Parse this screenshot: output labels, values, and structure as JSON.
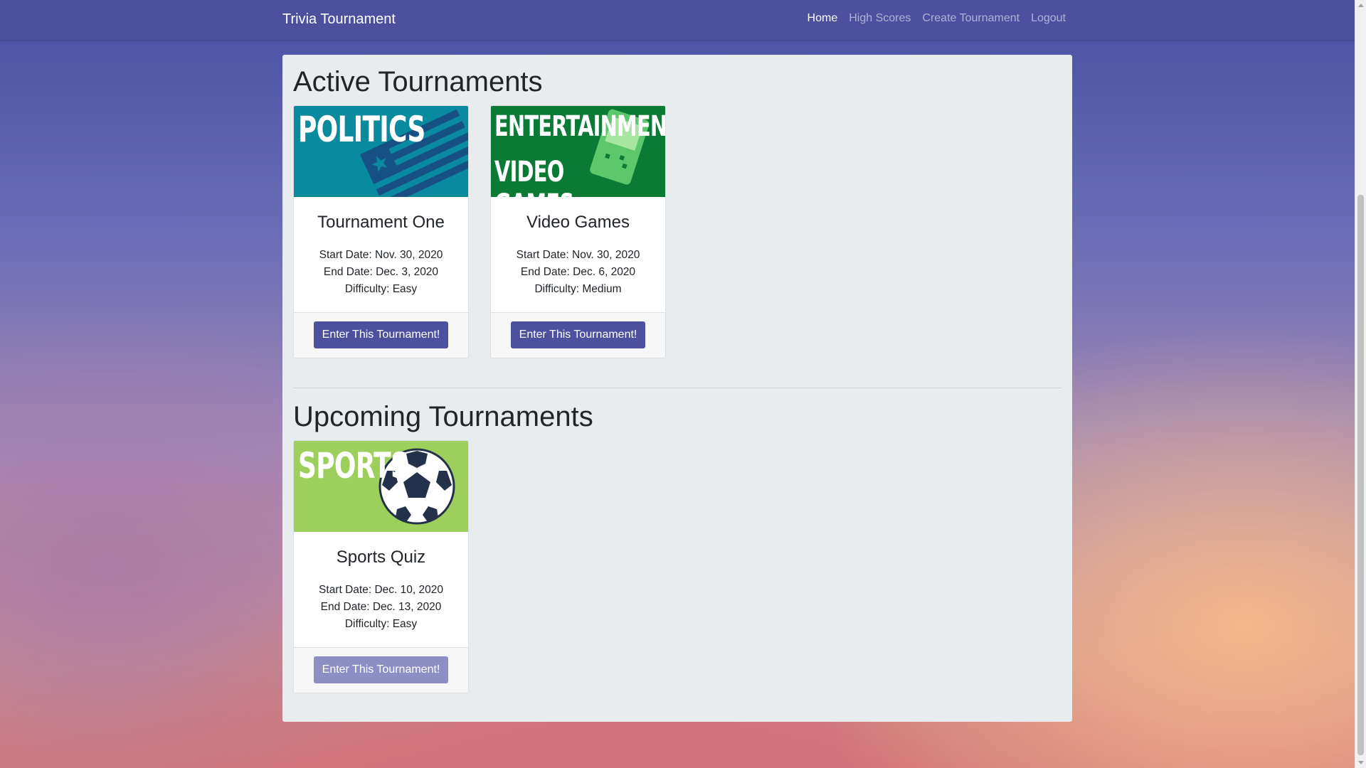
{
  "navbar": {
    "brand": "Trivia Tournament",
    "links": [
      "Home",
      "High Scores",
      "Create Tournament",
      "Logout"
    ],
    "active_index": 0
  },
  "sections": {
    "active": {
      "title": "Active Tournaments",
      "cards": [
        {
          "image_label": "POLITICS",
          "image_color": "#0a8a9e",
          "title": "Tournament One",
          "start": "Start Date: Nov. 30, 2020",
          "end": "End Date: Dec. 3, 2020",
          "difficulty": "Difficulty: Easy",
          "button": "Enter This Tournament!"
        },
        {
          "image_label_1": "ENTERTAINMENT:",
          "image_label_2": "VIDEO GAMES",
          "image_color": "#0b7a34",
          "title": "Video Games",
          "start": "Start Date: Nov. 30, 2020",
          "end": "End Date: Dec. 6, 2020",
          "difficulty": "Difficulty: Medium",
          "button": "Enter This Tournament!"
        }
      ]
    },
    "upcoming": {
      "title": "Upcoming Tournaments",
      "cards": [
        {
          "image_label": "SPORTS",
          "image_color": "#9ccf5c",
          "title": "Sports Quiz",
          "start": "Start Date: Dec. 10, 2020",
          "end": "End Date: Dec. 13, 2020",
          "difficulty": "Difficulty: Easy",
          "button": "Enter This Tournament!",
          "button_disabled": true
        }
      ]
    }
  },
  "colors": {
    "navbar": "#4d509e",
    "button": "#4d509e",
    "button_disabled": "#8d8fc4",
    "panel": "#e9ecef"
  }
}
